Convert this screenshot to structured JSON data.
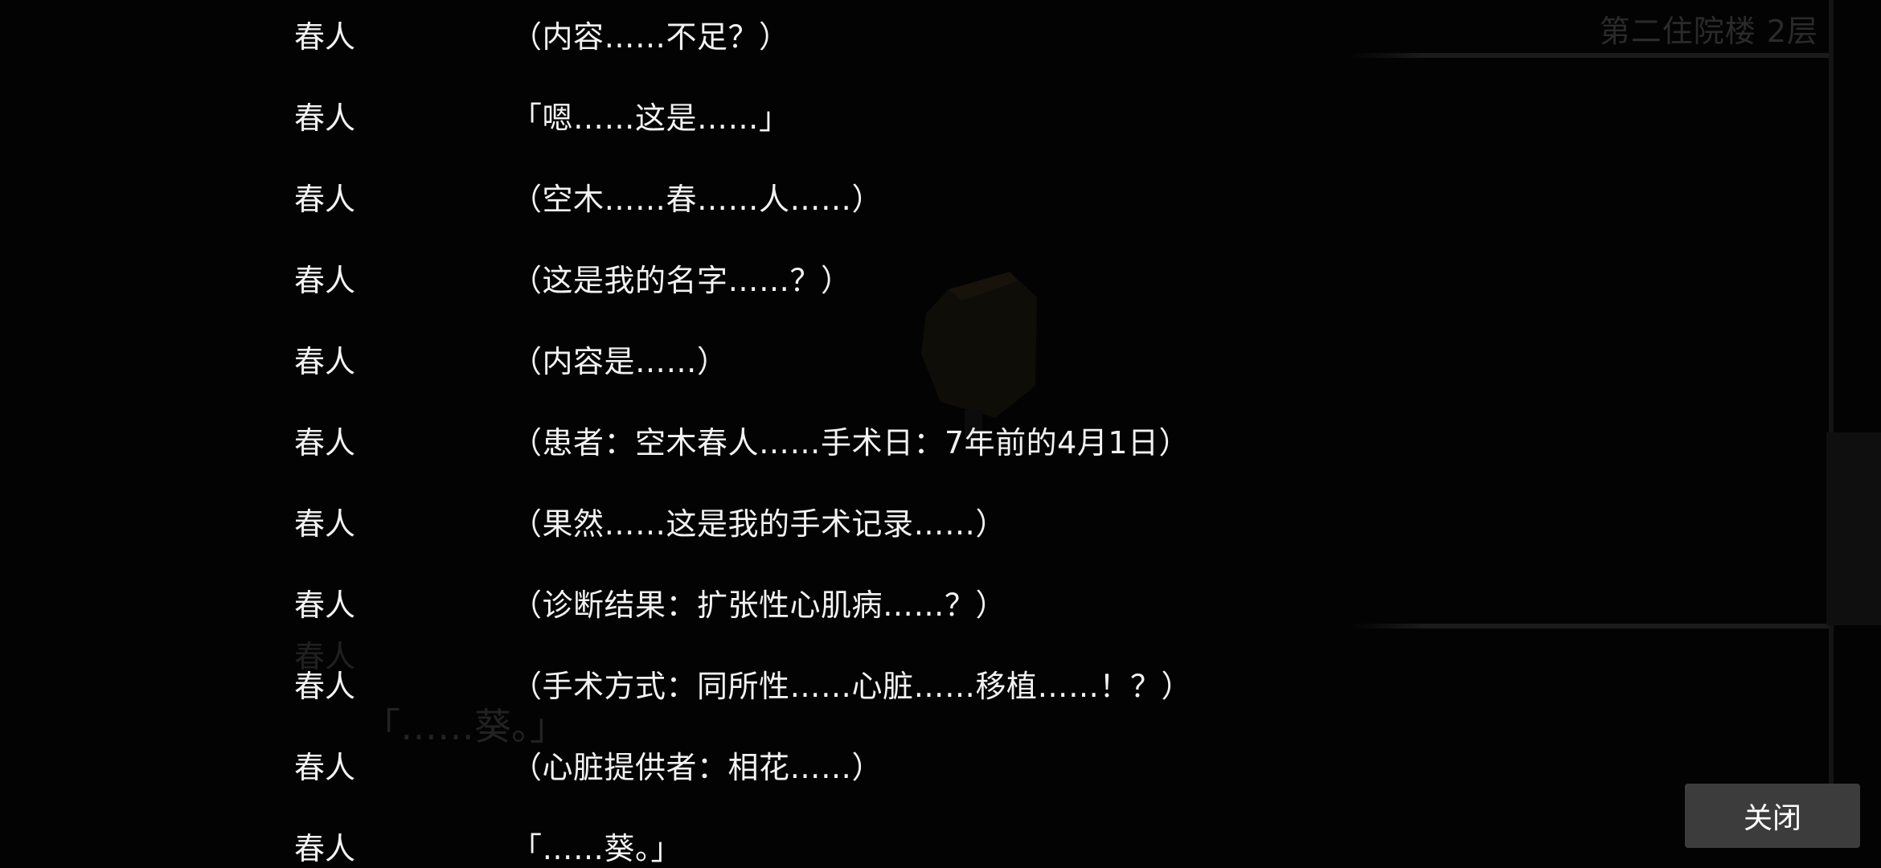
{
  "background": {
    "location_label": "第二住院楼 2层",
    "ghost_speaker": "春人",
    "ghost_line": "「……葵。」"
  },
  "backlog": {
    "entries": [
      {
        "speaker": "春人",
        "text": "（内容……不足？）"
      },
      {
        "speaker": "春人",
        "text": "「嗯……这是……」"
      },
      {
        "speaker": "春人",
        "text": "（空木……春……人……）"
      },
      {
        "speaker": "春人",
        "text": "（这是我的名字……？）"
      },
      {
        "speaker": "春人",
        "text": "（内容是……）"
      },
      {
        "speaker": "春人",
        "text": "（患者：空木春人……手术日：7年前的4月1日）"
      },
      {
        "speaker": "春人",
        "text": "（果然……这是我的手术记录……）"
      },
      {
        "speaker": "春人",
        "text": "（诊断结果：扩张性心肌病……？）"
      },
      {
        "speaker": "春人",
        "text": "（手术方式：同所性……心脏……移植……！？）"
      },
      {
        "speaker": "春人",
        "text": "（心脏提供者：相花……）"
      },
      {
        "speaker": "春人",
        "text": "「……葵。」"
      }
    ]
  },
  "controls": {
    "close_label": "关闭"
  }
}
